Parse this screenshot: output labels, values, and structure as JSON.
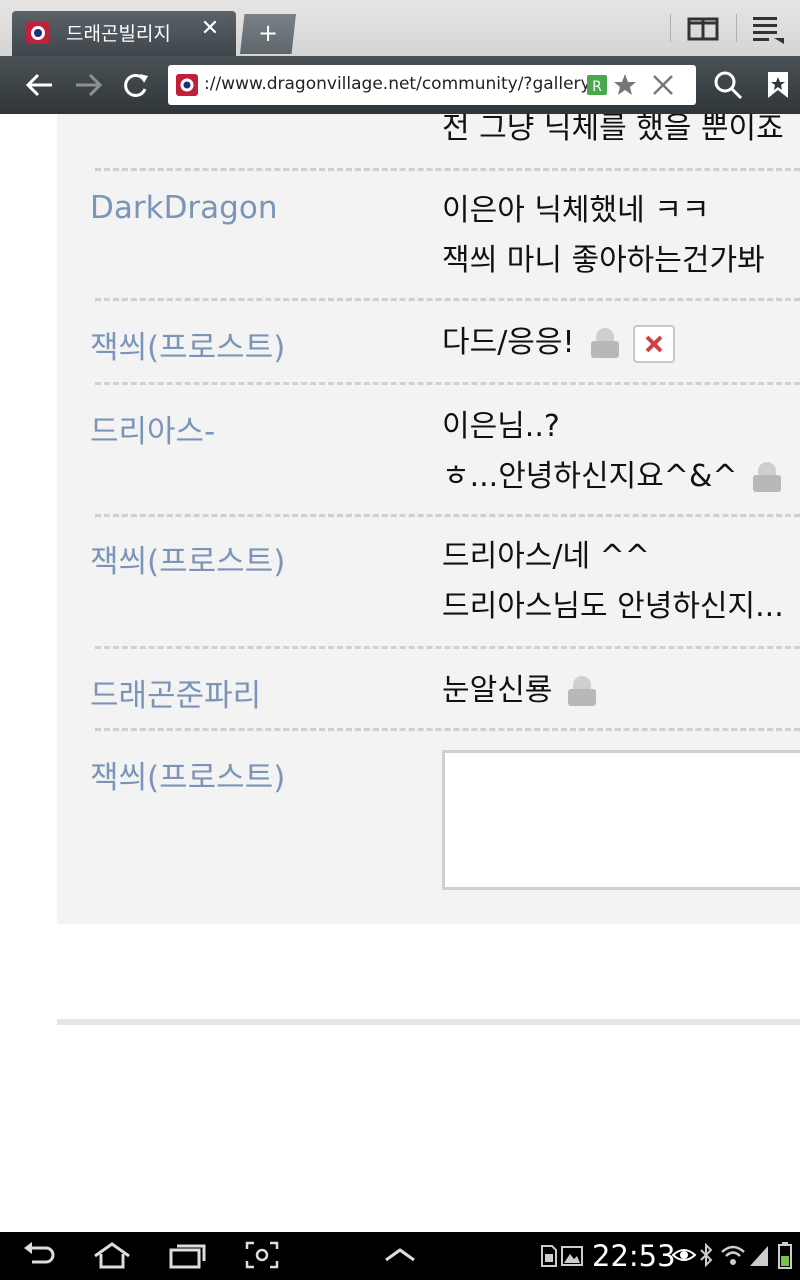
{
  "browser": {
    "tab": {
      "title": "드래곤빌리지",
      "close_icon": "close-icon"
    },
    "new_tab_label": "+",
    "url": "://www.dragonvillage.net/community/?gallery"
  },
  "comments": [
    {
      "name": "",
      "lines": [
        "전 그냥 닉체를 했을 뿐이죠"
      ],
      "lock": false,
      "xbtn": false
    },
    {
      "name": "DarkDragon",
      "lines": [
        "이은아 닉체했네 ㅋㅋ",
        "잭씌 마니 좋아하는건가봐"
      ],
      "lock": false,
      "xbtn": false
    },
    {
      "name": "잭씌(프로스트)",
      "lines": [
        "다드/응응!"
      ],
      "lock": true,
      "xbtn": true
    },
    {
      "name": "드리아스-",
      "lines": [
        "이은님..?",
        "ㅎ...안녕하신지요^&^"
      ],
      "lock": true,
      "xbtn": false
    },
    {
      "name": "잭씌(프로스트)",
      "lines": [
        "드리아스/네 ^^",
        "드리아스님도 안녕하신지..."
      ],
      "lock": false,
      "xbtn": false
    },
    {
      "name": "드래곤준파리",
      "lines": [
        "눈알신룡"
      ],
      "lock": true,
      "xbtn": false
    }
  ],
  "reply": {
    "name": "잭씌(프로스트)",
    "value": ""
  },
  "statusbar": {
    "time": "22:53"
  },
  "colors": {
    "name_link": "#7b95b8",
    "content_bg": "#f3f3f3",
    "toolbar": "#3a4044"
  }
}
